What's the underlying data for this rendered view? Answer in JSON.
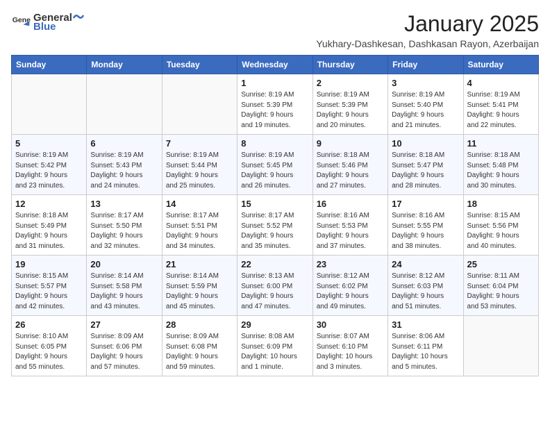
{
  "logo": {
    "general": "General",
    "blue": "Blue"
  },
  "title": "January 2025",
  "subtitle": "Yukhary-Dashkesan, Dashkasan Rayon, Azerbaijan",
  "weekdays": [
    "Sunday",
    "Monday",
    "Tuesday",
    "Wednesday",
    "Thursday",
    "Friday",
    "Saturday"
  ],
  "weeks": [
    [
      {
        "day": "",
        "info": ""
      },
      {
        "day": "",
        "info": ""
      },
      {
        "day": "",
        "info": ""
      },
      {
        "day": "1",
        "info": "Sunrise: 8:19 AM\nSunset: 5:39 PM\nDaylight: 9 hours\nand 19 minutes."
      },
      {
        "day": "2",
        "info": "Sunrise: 8:19 AM\nSunset: 5:39 PM\nDaylight: 9 hours\nand 20 minutes."
      },
      {
        "day": "3",
        "info": "Sunrise: 8:19 AM\nSunset: 5:40 PM\nDaylight: 9 hours\nand 21 minutes."
      },
      {
        "day": "4",
        "info": "Sunrise: 8:19 AM\nSunset: 5:41 PM\nDaylight: 9 hours\nand 22 minutes."
      }
    ],
    [
      {
        "day": "5",
        "info": "Sunrise: 8:19 AM\nSunset: 5:42 PM\nDaylight: 9 hours\nand 23 minutes."
      },
      {
        "day": "6",
        "info": "Sunrise: 8:19 AM\nSunset: 5:43 PM\nDaylight: 9 hours\nand 24 minutes."
      },
      {
        "day": "7",
        "info": "Sunrise: 8:19 AM\nSunset: 5:44 PM\nDaylight: 9 hours\nand 25 minutes."
      },
      {
        "day": "8",
        "info": "Sunrise: 8:19 AM\nSunset: 5:45 PM\nDaylight: 9 hours\nand 26 minutes."
      },
      {
        "day": "9",
        "info": "Sunrise: 8:18 AM\nSunset: 5:46 PM\nDaylight: 9 hours\nand 27 minutes."
      },
      {
        "day": "10",
        "info": "Sunrise: 8:18 AM\nSunset: 5:47 PM\nDaylight: 9 hours\nand 28 minutes."
      },
      {
        "day": "11",
        "info": "Sunrise: 8:18 AM\nSunset: 5:48 PM\nDaylight: 9 hours\nand 30 minutes."
      }
    ],
    [
      {
        "day": "12",
        "info": "Sunrise: 8:18 AM\nSunset: 5:49 PM\nDaylight: 9 hours\nand 31 minutes."
      },
      {
        "day": "13",
        "info": "Sunrise: 8:17 AM\nSunset: 5:50 PM\nDaylight: 9 hours\nand 32 minutes."
      },
      {
        "day": "14",
        "info": "Sunrise: 8:17 AM\nSunset: 5:51 PM\nDaylight: 9 hours\nand 34 minutes."
      },
      {
        "day": "15",
        "info": "Sunrise: 8:17 AM\nSunset: 5:52 PM\nDaylight: 9 hours\nand 35 minutes."
      },
      {
        "day": "16",
        "info": "Sunrise: 8:16 AM\nSunset: 5:53 PM\nDaylight: 9 hours\nand 37 minutes."
      },
      {
        "day": "17",
        "info": "Sunrise: 8:16 AM\nSunset: 5:55 PM\nDaylight: 9 hours\nand 38 minutes."
      },
      {
        "day": "18",
        "info": "Sunrise: 8:15 AM\nSunset: 5:56 PM\nDaylight: 9 hours\nand 40 minutes."
      }
    ],
    [
      {
        "day": "19",
        "info": "Sunrise: 8:15 AM\nSunset: 5:57 PM\nDaylight: 9 hours\nand 42 minutes."
      },
      {
        "day": "20",
        "info": "Sunrise: 8:14 AM\nSunset: 5:58 PM\nDaylight: 9 hours\nand 43 minutes."
      },
      {
        "day": "21",
        "info": "Sunrise: 8:14 AM\nSunset: 5:59 PM\nDaylight: 9 hours\nand 45 minutes."
      },
      {
        "day": "22",
        "info": "Sunrise: 8:13 AM\nSunset: 6:00 PM\nDaylight: 9 hours\nand 47 minutes."
      },
      {
        "day": "23",
        "info": "Sunrise: 8:12 AM\nSunset: 6:02 PM\nDaylight: 9 hours\nand 49 minutes."
      },
      {
        "day": "24",
        "info": "Sunrise: 8:12 AM\nSunset: 6:03 PM\nDaylight: 9 hours\nand 51 minutes."
      },
      {
        "day": "25",
        "info": "Sunrise: 8:11 AM\nSunset: 6:04 PM\nDaylight: 9 hours\nand 53 minutes."
      }
    ],
    [
      {
        "day": "26",
        "info": "Sunrise: 8:10 AM\nSunset: 6:05 PM\nDaylight: 9 hours\nand 55 minutes."
      },
      {
        "day": "27",
        "info": "Sunrise: 8:09 AM\nSunset: 6:06 PM\nDaylight: 9 hours\nand 57 minutes."
      },
      {
        "day": "28",
        "info": "Sunrise: 8:09 AM\nSunset: 6:08 PM\nDaylight: 9 hours\nand 59 minutes."
      },
      {
        "day": "29",
        "info": "Sunrise: 8:08 AM\nSunset: 6:09 PM\nDaylight: 10 hours\nand 1 minute."
      },
      {
        "day": "30",
        "info": "Sunrise: 8:07 AM\nSunset: 6:10 PM\nDaylight: 10 hours\nand 3 minutes."
      },
      {
        "day": "31",
        "info": "Sunrise: 8:06 AM\nSunset: 6:11 PM\nDaylight: 10 hours\nand 5 minutes."
      },
      {
        "day": "",
        "info": ""
      }
    ]
  ]
}
